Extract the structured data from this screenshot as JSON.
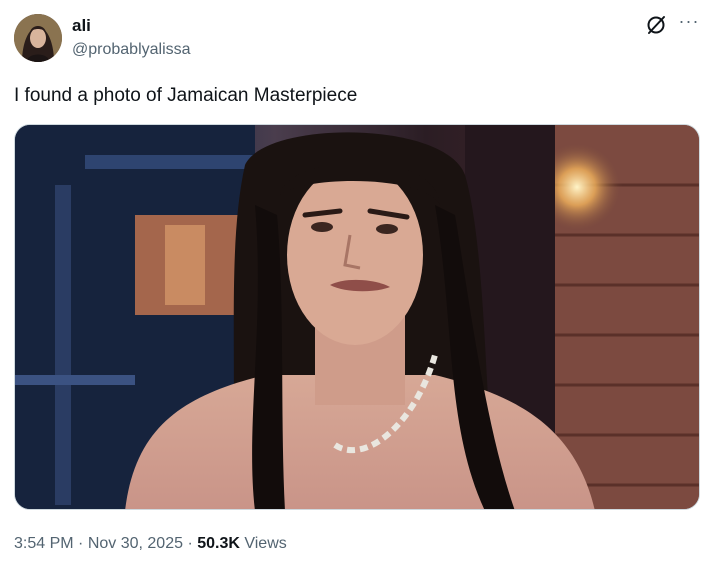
{
  "author": {
    "display_name": "ali",
    "handle": "@probablyalissa",
    "avatar_icon": "profile-avatar"
  },
  "actions": {
    "grok_icon": "grok-icon",
    "more_icon": "more-icon",
    "more_glyph": "···"
  },
  "tweet": {
    "text": "I found a photo of Jamaican Masterpiece"
  },
  "media": {
    "kind": "photo"
  },
  "meta": {
    "time": "3:54 PM",
    "separator": " · ",
    "date": "Nov 30, 2025",
    "views_count": "50.3K",
    "views_label": " Views"
  },
  "colors": {
    "text_primary": "#0f1419",
    "text_secondary": "#536471",
    "border": "#cfd9de"
  }
}
